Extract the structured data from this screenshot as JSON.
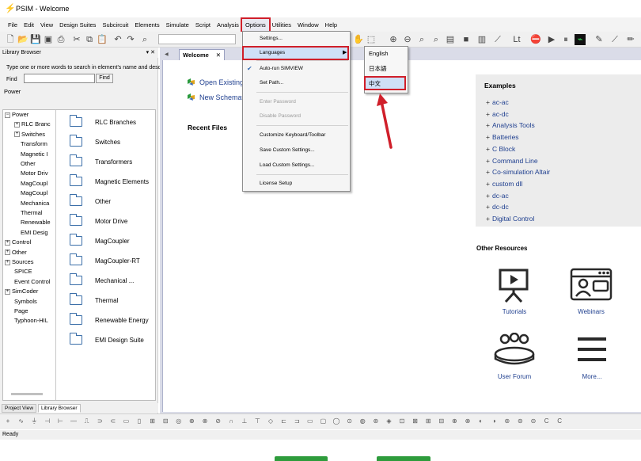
{
  "window": {
    "title": "PSIM - Welcome"
  },
  "menubar": {
    "items": [
      "File",
      "Edit",
      "View",
      "Design Suites",
      "Subcircuit",
      "Elements",
      "Simulate",
      "Script",
      "Analysis",
      "Options",
      "Utilities",
      "Window",
      "Help"
    ]
  },
  "library": {
    "header": "Library Browser",
    "header_controls": "▾ ✕",
    "hint": "Type one or more words to search in element's name and desc",
    "find_label": "Find",
    "find_button": "Find",
    "category": "Power",
    "tree": [
      {
        "label": "Power",
        "pm": "−",
        "indent": 0
      },
      {
        "label": "RLC Branc",
        "pm": "+",
        "indent": 1
      },
      {
        "label": "Switches",
        "pm": "+",
        "indent": 1
      },
      {
        "label": "Transform",
        "pm": "",
        "indent": 2
      },
      {
        "label": "Magnetic I",
        "pm": "",
        "indent": 2
      },
      {
        "label": "Other",
        "pm": "",
        "indent": 2
      },
      {
        "label": "Motor Driv",
        "pm": "",
        "indent": 2
      },
      {
        "label": "MagCoupl",
        "pm": "",
        "indent": 2
      },
      {
        "label": "MagCoupl",
        "pm": "",
        "indent": 2
      },
      {
        "label": "Mechanica",
        "pm": "",
        "indent": 2
      },
      {
        "label": "Thermal",
        "pm": "",
        "indent": 2
      },
      {
        "label": "Renewable",
        "pm": "",
        "indent": 2
      },
      {
        "label": "EMI Desig",
        "pm": "",
        "indent": 2
      },
      {
        "label": "Control",
        "pm": "+",
        "indent": 0
      },
      {
        "label": "Other",
        "pm": "+",
        "indent": 0
      },
      {
        "label": "Sources",
        "pm": "+",
        "indent": 0
      },
      {
        "label": "SPICE",
        "pm": "",
        "indent": 1
      },
      {
        "label": "Event Control",
        "pm": "",
        "indent": 1
      },
      {
        "label": "SimCoder",
        "pm": "+",
        "indent": 0
      },
      {
        "label": "Symbols",
        "pm": "",
        "indent": 1
      },
      {
        "label": "Page",
        "pm": "",
        "indent": 1
      },
      {
        "label": "Typhoon-HIL",
        "pm": "",
        "indent": 1
      }
    ],
    "folders": [
      "RLC Branches",
      "Switches",
      "Transformers",
      "Magnetic Elements",
      "Other",
      "Motor Drive",
      "MagCoupler",
      "MagCoupler-RT",
      "Mechanical ...",
      "Thermal",
      "Renewable Energy",
      "EMI Design Suite"
    ],
    "tabs": [
      "Project View",
      "Library Browser"
    ]
  },
  "welcome": {
    "tab_label": "Welcome",
    "tab_close": "✕",
    "open_existing": "Open Existing",
    "new_schematic": "New Schemat",
    "recent_files": "Recent Files",
    "examples_title": "Examples",
    "examples": [
      "ac-ac",
      "ac-dc",
      "Analysis Tools",
      "Batteries",
      "C Block",
      "Command Line",
      "Co-simulation Altair",
      "custom dll",
      "dc-ac",
      "dc-dc",
      "Digital Control"
    ],
    "other_resources_title": "Other Resources",
    "resources": [
      "Tutorials",
      "Webinars",
      "User Forum",
      "More..."
    ]
  },
  "options_menu": {
    "items": [
      {
        "label": "Settings...",
        "disabled": false
      },
      {
        "label": "Languages",
        "disabled": false
      },
      {
        "label": "Auto-run SIMVIEW",
        "disabled": false,
        "checked": true
      },
      {
        "label": "Set Path...",
        "disabled": false
      },
      {
        "label": "Enter Password",
        "disabled": true
      },
      {
        "label": "Disable Password",
        "disabled": true
      },
      {
        "label": "Customize Keyboard/Toolbar",
        "disabled": false
      },
      {
        "label": "Save Custom Settings...",
        "disabled": false
      },
      {
        "label": "Load Custom Settings...",
        "disabled": false
      },
      {
        "label": "License Setup",
        "disabled": false
      }
    ]
  },
  "languages_menu": {
    "items": [
      "English",
      "日本語",
      "中文"
    ],
    "highlighted": "中文"
  },
  "status": {
    "text": "Ready"
  },
  "colors": {
    "highlight_red": "#d01f2a",
    "link_blue": "#1f3f8f",
    "folder_blue": "#3a6ea8",
    "green_button": "#2e9c3c"
  }
}
